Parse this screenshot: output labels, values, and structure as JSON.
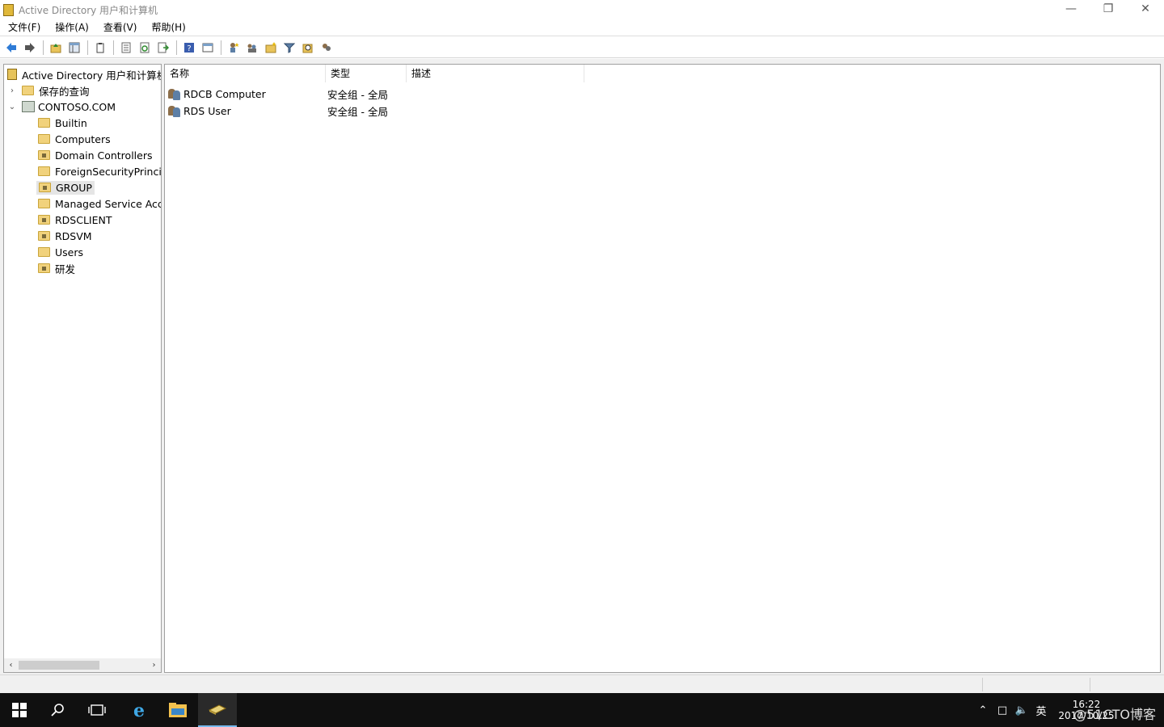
{
  "window": {
    "title": "Active Directory 用户和计算机"
  },
  "menu": [
    "文件(F)",
    "操作(A)",
    "查看(V)",
    "帮助(H)"
  ],
  "toolbar": {
    "icons": [
      "back-icon",
      "forward-icon",
      "up-folder-icon",
      "show-hide-tree-icon",
      "clipboard-icon",
      "properties-icon",
      "refresh-icon",
      "export-icon",
      "help-icon",
      "view-icon",
      "new-user-icon",
      "new-group-icon",
      "new-ou-icon",
      "filter-icon",
      "find-icon",
      "add-to-group-icon"
    ]
  },
  "tree": {
    "root": "Active Directory 用户和计算机",
    "saved_queries": "保存的查询",
    "domain": "CONTOSO.COM",
    "items": [
      "Builtin",
      "Computers",
      "Domain Controllers",
      "ForeignSecurityPrincipals",
      "GROUP",
      "Managed Service Accounts",
      "RDSCLIENT",
      "RDSVM",
      "Users",
      "研发"
    ],
    "selected": "GROUP"
  },
  "list": {
    "columns": {
      "name": "名称",
      "type": "类型",
      "desc": "描述"
    },
    "rows": [
      {
        "name": "RDCB Computer",
        "type": "安全组 - 全局",
        "desc": ""
      },
      {
        "name": "RDS User",
        "type": "安全组 - 全局",
        "desc": ""
      }
    ]
  },
  "taskbar": {
    "clock_time": "16:22",
    "clock_date": "2017/10/25",
    "ime": "英",
    "watermark": "@51CTO博客"
  }
}
